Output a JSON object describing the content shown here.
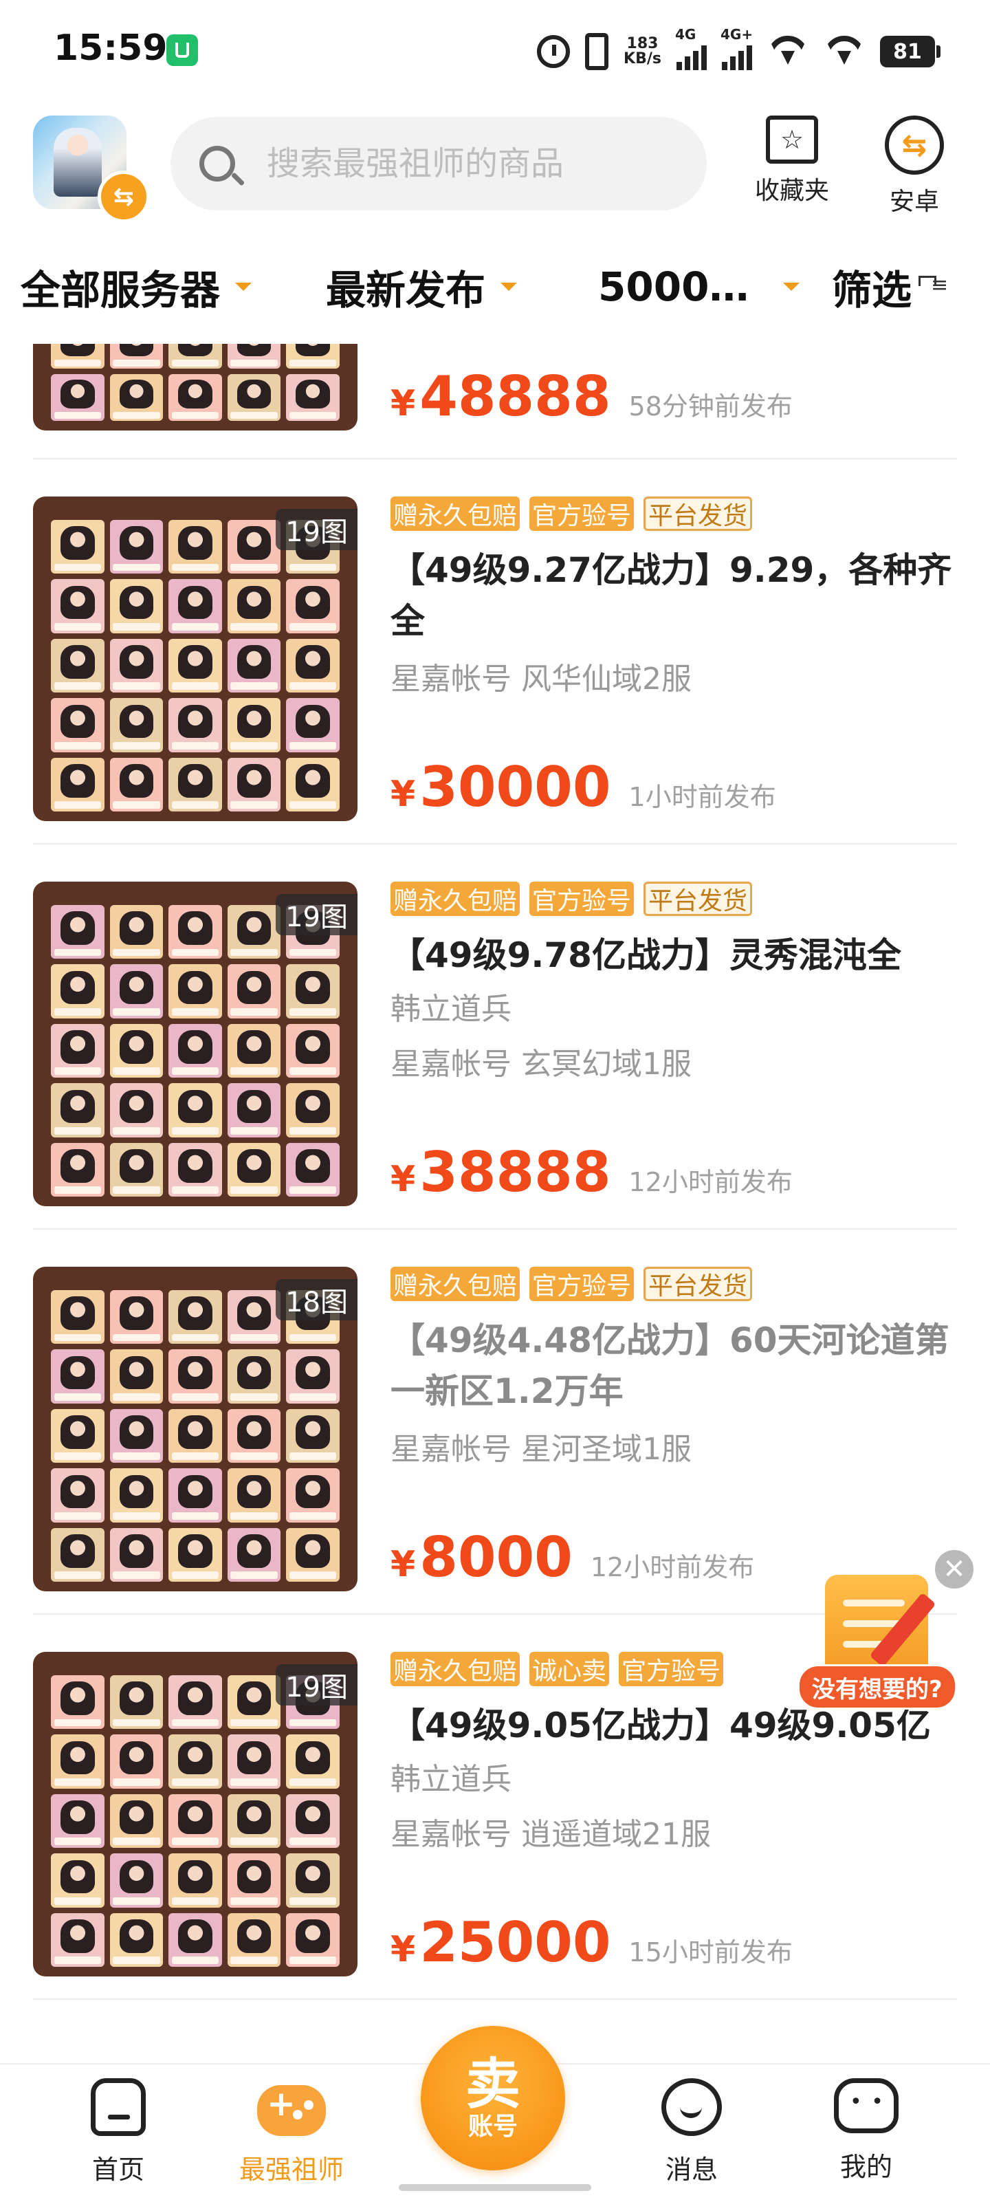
{
  "status_bar": {
    "time": "15:59",
    "net_speed_value": "183",
    "net_speed_unit": "KB/s",
    "signal1_label": "4G",
    "signal2_label": "4G+",
    "battery": "81"
  },
  "header": {
    "search_placeholder": "搜索最强祖师的商品",
    "favorites_label": "收藏夹",
    "platform_label": "安卓"
  },
  "filters": {
    "server": "全部服务器",
    "sort": "最新发布",
    "price": "5000…",
    "filter": "筛选"
  },
  "listings": [
    {
      "image_count": "",
      "tags": [],
      "title": "",
      "seller": "",
      "price": "48888",
      "time": "58分钟前发布"
    },
    {
      "image_count": "19图",
      "tags": [
        "赠永久包赔",
        "官方验号",
        "平台发货"
      ],
      "title": "【49级9.27亿战力】9.29，各种齐全",
      "seller": "星嘉帐号 风华仙域2服",
      "price": "30000",
      "time": "1小时前发布"
    },
    {
      "image_count": "19图",
      "tags": [
        "赠永久包赔",
        "官方验号",
        "平台发货"
      ],
      "title": "【49级9.78亿战力】灵秀混沌全",
      "subtitle": "韩立道兵",
      "seller": "星嘉帐号 玄冥幻域1服",
      "price": "38888",
      "time": "12小时前发布"
    },
    {
      "image_count": "18图",
      "tags": [
        "赠永久包赔",
        "官方验号",
        "平台发货"
      ],
      "title": "【49级4.48亿战力】60天河论道第一新区1.2万年",
      "seller": "星嘉帐号 星河圣域1服",
      "price": "8000",
      "time": "12小时前发布"
    },
    {
      "image_count": "19图",
      "tags": [
        "赠永久包赔",
        "诚心卖",
        "官方验号"
      ],
      "title": "【49级9.05亿战力】49级9.05亿",
      "subtitle": "韩立道兵",
      "seller": "星嘉帐号 逍遥道域21服",
      "price": "25000",
      "time": "15小时前发布"
    }
  ],
  "currency_symbol": "¥",
  "floating": {
    "bubble": "没有想要的?",
    "close": "✕"
  },
  "bottom_nav": {
    "home": "首页",
    "game": "最强祖师",
    "sell_big": "卖",
    "sell_small": "账号",
    "messages": "消息",
    "mine": "我的"
  },
  "colors": {
    "accent": "#f29a1a",
    "price": "#f04a1a",
    "tag_fill": "#f5a83a"
  }
}
